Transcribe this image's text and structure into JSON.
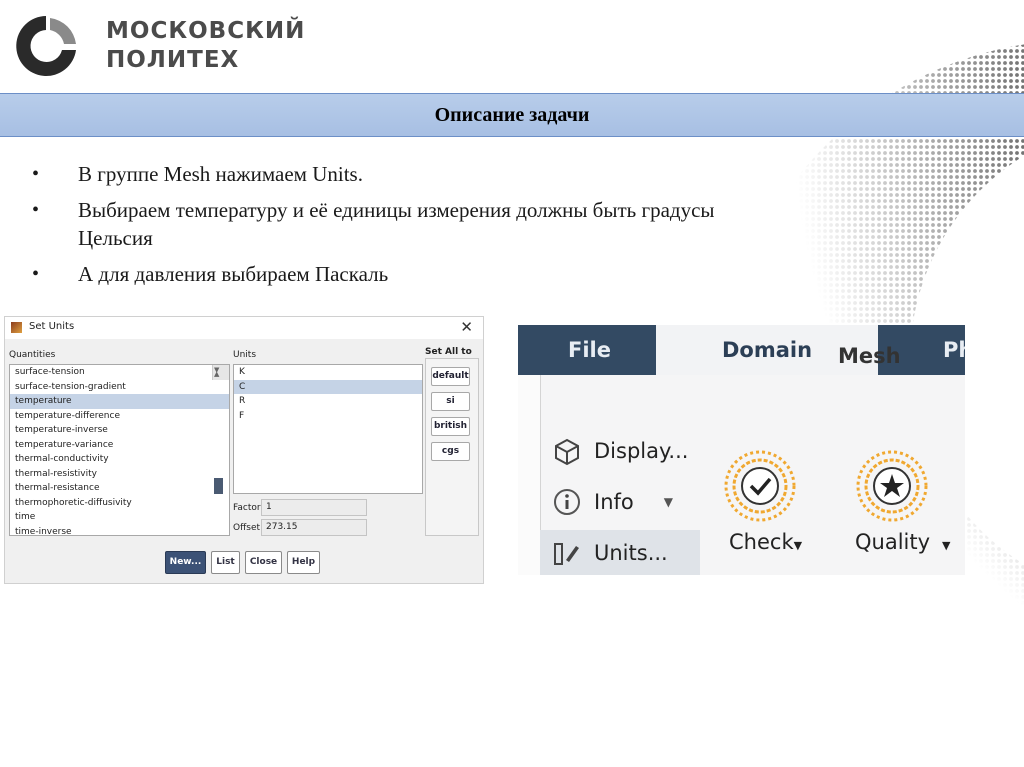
{
  "logo": {
    "line1": "МОСКОВСКИЙ",
    "line2": "ПОЛИТЕХ"
  },
  "slide": {
    "title": "Описание задачи",
    "bullets": [
      "В группе Mesh нажимаем Units.",
      "Выбираем температуру и её единицы измерения должны быть градусы Цельсия",
      "А для давления выбираем Паскаль"
    ]
  },
  "set_units": {
    "title": "Set Units",
    "quantities_label": "Quantities",
    "quantities": [
      "surface-tension",
      "surface-tension-gradient",
      "temperature",
      "temperature-difference",
      "temperature-inverse",
      "temperature-variance",
      "thermal-conductivity",
      "thermal-resistivity",
      "thermal-resistance",
      "thermophoretic-diffusivity",
      "time",
      "time-inverse"
    ],
    "selected_quantity": "temperature",
    "units_label": "Units",
    "units": [
      "K",
      "C",
      "R",
      "F"
    ],
    "selected_unit": "C",
    "factor_label": "Factor",
    "factor_value": "1",
    "offset_label": "Offset",
    "offset_value": "273.15",
    "set_all_label": "Set All to",
    "set_all_buttons": [
      "default",
      "si",
      "british",
      "cgs"
    ],
    "buttons": [
      "New...",
      "List",
      "Close",
      "Help"
    ]
  },
  "ribbon": {
    "tabs": [
      "File",
      "Domain",
      "Ph"
    ],
    "active_tab": "Domain",
    "group_label": "Mesh",
    "items": [
      "Display...",
      "Info",
      "Units..."
    ],
    "mesh_buttons": [
      "Check",
      "Quality"
    ],
    "accent_color": "#f0a830",
    "tab_bar_color": "#334a63"
  }
}
